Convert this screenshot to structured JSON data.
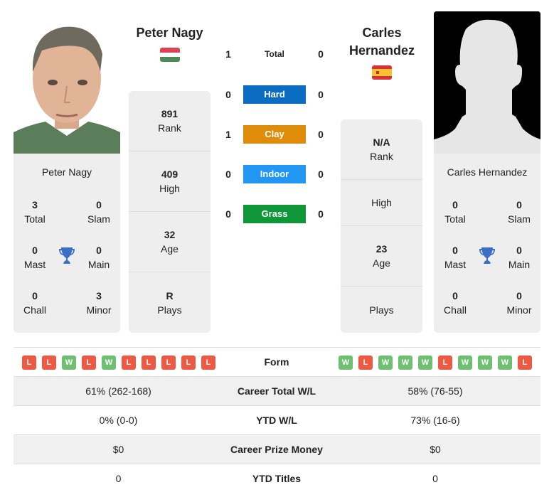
{
  "player_left": {
    "name": "Peter Nagy",
    "flag": "hungary-flag",
    "card_name": "Peter Nagy",
    "titles": {
      "total": {
        "value": "3",
        "label": "Total"
      },
      "slam": {
        "value": "0",
        "label": "Slam"
      },
      "mast": {
        "value": "0",
        "label": "Mast"
      },
      "main": {
        "value": "0",
        "label": "Main"
      },
      "chall": {
        "value": "0",
        "label": "Chall"
      },
      "minor": {
        "value": "3",
        "label": "Minor"
      }
    },
    "stats": [
      {
        "value": "891",
        "label": "Rank"
      },
      {
        "value": "409",
        "label": "High"
      },
      {
        "value": "32",
        "label": "Age"
      },
      {
        "value": "R",
        "label": "Plays"
      }
    ],
    "form": [
      "L",
      "L",
      "W",
      "L",
      "W",
      "L",
      "L",
      "L",
      "L",
      "L"
    ]
  },
  "player_right": {
    "name": "Carles Hernandez",
    "flag": "spain-flag",
    "card_name": "Carles Hernandez",
    "titles": {
      "total": {
        "value": "0",
        "label": "Total"
      },
      "slam": {
        "value": "0",
        "label": "Slam"
      },
      "mast": {
        "value": "0",
        "label": "Mast"
      },
      "main": {
        "value": "0",
        "label": "Main"
      },
      "chall": {
        "value": "0",
        "label": "Chall"
      },
      "minor": {
        "value": "0",
        "label": "Minor"
      }
    },
    "stats": [
      {
        "value": "N/A",
        "label": "Rank"
      },
      {
        "value": "",
        "label": "High"
      },
      {
        "value": "23",
        "label": "Age"
      },
      {
        "value": "",
        "label": "Plays"
      }
    ],
    "form": [
      "W",
      "L",
      "W",
      "W",
      "W",
      "L",
      "W",
      "W",
      "W",
      "L"
    ]
  },
  "h2h": [
    {
      "label": "Total",
      "left": "1",
      "right": "0",
      "color": null
    },
    {
      "label": "Hard",
      "left": "0",
      "right": "0",
      "color": "#0a6dc2"
    },
    {
      "label": "Clay",
      "left": "1",
      "right": "0",
      "color": "#de8c0a"
    },
    {
      "label": "Indoor",
      "left": "0",
      "right": "0",
      "color": "#2196f3"
    },
    {
      "label": "Grass",
      "left": "0",
      "right": "0",
      "color": "#0e9638"
    }
  ],
  "comparison": {
    "form_label": "Form",
    "rows": [
      {
        "label": "Career Total W/L",
        "left": "61% (262-168)",
        "right": "58% (76-55)"
      },
      {
        "label": "YTD W/L",
        "left": "0% (0-0)",
        "right": "73% (16-6)"
      },
      {
        "label": "Career Prize Money",
        "left": "$0",
        "right": "$0"
      },
      {
        "label": "YTD Titles",
        "left": "0",
        "right": "0"
      }
    ]
  },
  "colors": {
    "win": "#6fbf73",
    "loss": "#ec5a44",
    "trophy": "#3a6fc4",
    "card_bg": "#eeeeee"
  }
}
